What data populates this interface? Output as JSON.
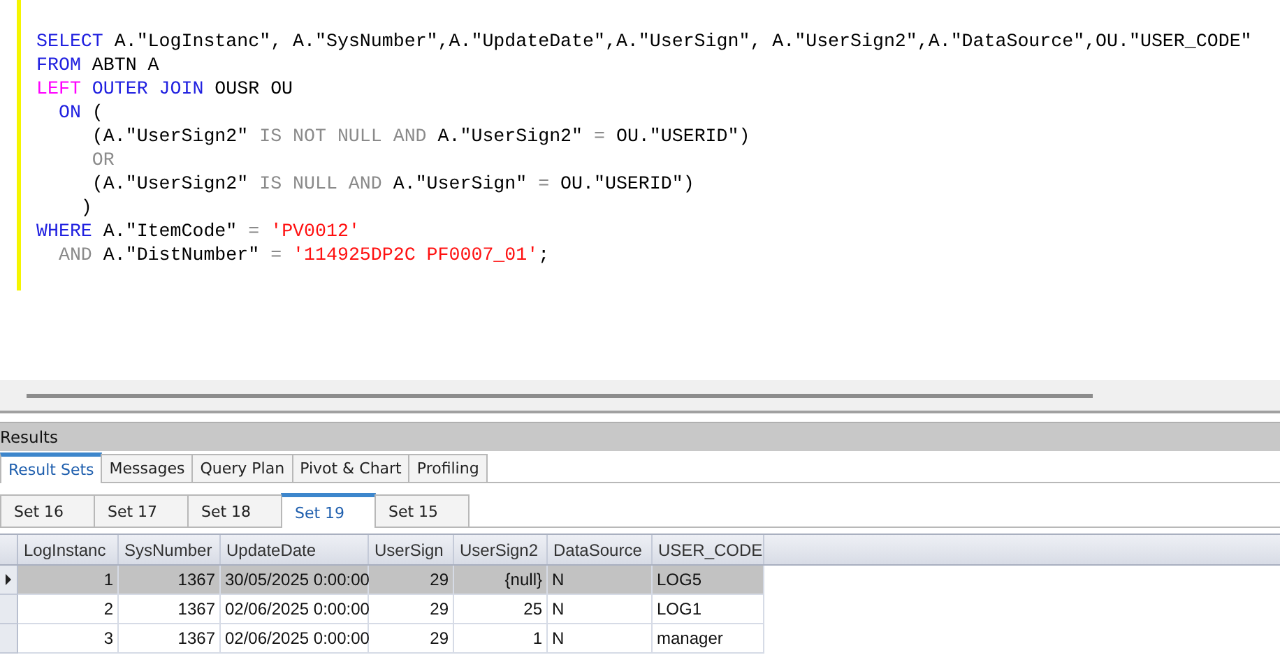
{
  "editor": {
    "lines": [
      [
        {
          "kind": "keyword",
          "text": "SELECT"
        },
        {
          "kind": "plain",
          "text": " A.\"LogInstanc\", A.\"SysNumber\",A.\"UpdateDate\",A.\"UserSign\", A.\"UserSign2\",A.\"DataSource\",OU.\"USER_CODE\""
        }
      ],
      [
        {
          "kind": "keyword",
          "text": "FROM"
        },
        {
          "kind": "plain",
          "text": " ABTN A"
        }
      ],
      [
        {
          "kind": "function",
          "text": "LEFT"
        },
        {
          "kind": "keyword",
          "text": " OUTER JOIN"
        },
        {
          "kind": "plain",
          "text": " OUSR OU"
        }
      ],
      [
        {
          "kind": "keyword",
          "text": "  ON"
        },
        {
          "kind": "plain",
          "text": " ("
        }
      ],
      [
        {
          "kind": "plain",
          "text": "     (A.\"UserSign2\" "
        },
        {
          "kind": "operator",
          "text": "IS NOT NULL AND"
        },
        {
          "kind": "plain",
          "text": " A.\"UserSign2\" "
        },
        {
          "kind": "operator",
          "text": "="
        },
        {
          "kind": "plain",
          "text": " OU.\"USERID\")"
        }
      ],
      [
        {
          "kind": "operator",
          "text": "     OR"
        }
      ],
      [
        {
          "kind": "plain",
          "text": "     (A.\"UserSign2\" "
        },
        {
          "kind": "operator",
          "text": "IS NULL AND"
        },
        {
          "kind": "plain",
          "text": " A.\"UserSign\" "
        },
        {
          "kind": "operator",
          "text": "="
        },
        {
          "kind": "plain",
          "text": " OU.\"USERID\")"
        }
      ],
      [
        {
          "kind": "plain",
          "text": "    )"
        }
      ],
      [
        {
          "kind": "keyword",
          "text": "WHERE"
        },
        {
          "kind": "plain",
          "text": " A.\"ItemCode\" "
        },
        {
          "kind": "operator",
          "text": "= "
        },
        {
          "kind": "string",
          "text": "'PV0012'"
        }
      ],
      [
        {
          "kind": "operator",
          "text": "  AND"
        },
        {
          "kind": "plain",
          "text": " A.\"DistNumber\" "
        },
        {
          "kind": "operator",
          "text": "= "
        },
        {
          "kind": "string",
          "text": "'114925DP2C PF0007_01'"
        },
        {
          "kind": "plain",
          "text": ";"
        }
      ]
    ]
  },
  "results": {
    "title": "Results",
    "tabs": [
      {
        "label": "Result Sets",
        "selected": true
      },
      {
        "label": "Messages",
        "selected": false
      },
      {
        "label": "Query Plan",
        "selected": false
      },
      {
        "label": "Pivot & Chart",
        "selected": false
      },
      {
        "label": "Profiling",
        "selected": false
      }
    ],
    "set_tabs": [
      {
        "label": "Set 16",
        "selected": false
      },
      {
        "label": "Set 17",
        "selected": false
      },
      {
        "label": "Set 18",
        "selected": false
      },
      {
        "label": "Set 19",
        "selected": true
      },
      {
        "label": "Set 15",
        "selected": false
      }
    ],
    "table": {
      "columns": [
        {
          "label": "LogInstanc",
          "kind": "number"
        },
        {
          "label": "SysNumber",
          "kind": "number"
        },
        {
          "label": "UpdateDate",
          "kind": "text"
        },
        {
          "label": "UserSign",
          "kind": "number"
        },
        {
          "label": "UserSign2",
          "kind": "number"
        },
        {
          "label": "DataSource",
          "kind": "text"
        },
        {
          "label": "USER_CODE",
          "kind": "text"
        }
      ],
      "rows": [
        {
          "selected": true,
          "cells": [
            "1",
            "1367",
            "30/05/2025 0:00:00",
            "29",
            "{null}",
            "N",
            "LOG5"
          ]
        },
        {
          "selected": false,
          "cells": [
            "2",
            "1367",
            "02/06/2025 0:00:00",
            "29",
            "25",
            "N",
            "LOG1"
          ]
        },
        {
          "selected": false,
          "cells": [
            "3",
            "1367",
            "02/06/2025 0:00:00",
            "29",
            "1",
            "N",
            "manager"
          ]
        }
      ]
    }
  }
}
